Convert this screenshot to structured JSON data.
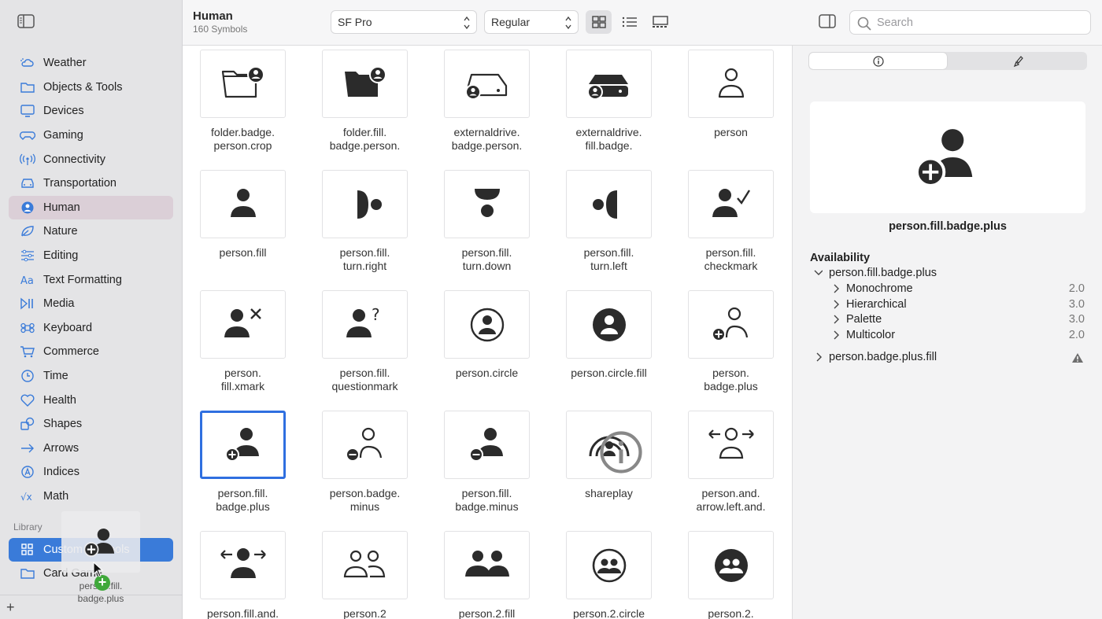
{
  "sidebar": {
    "categories": [
      {
        "label": "Weather",
        "icon": "cloud-sun-icon"
      },
      {
        "label": "Objects & Tools",
        "icon": "folder-icon"
      },
      {
        "label": "Devices",
        "icon": "display-icon"
      },
      {
        "label": "Gaming",
        "icon": "gamecontroller-icon"
      },
      {
        "label": "Connectivity",
        "icon": "antenna-icon"
      },
      {
        "label": "Transportation",
        "icon": "car-icon"
      },
      {
        "label": "Human",
        "icon": "person-circle-icon"
      },
      {
        "label": "Nature",
        "icon": "leaf-icon"
      },
      {
        "label": "Editing",
        "icon": "sliders-icon"
      },
      {
        "label": "Text Formatting",
        "icon": "textformat-icon"
      },
      {
        "label": "Media",
        "icon": "playpause-icon"
      },
      {
        "label": "Keyboard",
        "icon": "command-icon"
      },
      {
        "label": "Commerce",
        "icon": "cart-icon"
      },
      {
        "label": "Time",
        "icon": "clock-icon"
      },
      {
        "label": "Health",
        "icon": "heart-icon"
      },
      {
        "label": "Shapes",
        "icon": "shapes-icon"
      },
      {
        "label": "Arrows",
        "icon": "arrow-right-icon"
      },
      {
        "label": "Indices",
        "icon": "a-circle-icon"
      },
      {
        "label": "Math",
        "icon": "function-icon"
      }
    ],
    "selected_category": "Human",
    "library_label": "Library",
    "library": [
      {
        "label": "Custom Symbols",
        "icon": "grid-icon"
      },
      {
        "label": "Card Game",
        "icon": "folder-icon"
      }
    ],
    "drag_label": "person.fill.\nbadge.plus"
  },
  "toolbar": {
    "title": "Human",
    "subtitle": "160 Symbols",
    "font": "SF Pro",
    "weight": "Regular",
    "search_placeholder": "Search"
  },
  "grid": [
    {
      "label": "folder.badge.\nperson.crop",
      "icon": "folder-badge-person-icon"
    },
    {
      "label": "folder.fill.\nbadge.person.",
      "icon": "folder-fill-badge-person-icon"
    },
    {
      "label": "externaldrive.\nbadge.person.",
      "icon": "externaldrive-badge-person-icon"
    },
    {
      "label": "externaldrive.\nfill.badge.",
      "icon": "externaldrive-fill-badge-icon"
    },
    {
      "label": "person",
      "icon": "person-icon"
    },
    {
      "label": "person.fill",
      "icon": "person-fill-icon"
    },
    {
      "label": "person.fill.\nturn.right",
      "icon": "person-turn-right-icon"
    },
    {
      "label": "person.fill.\nturn.down",
      "icon": "person-turn-down-icon"
    },
    {
      "label": "person.fill.\nturn.left",
      "icon": "person-turn-left-icon"
    },
    {
      "label": "person.fill.\ncheckmark",
      "icon": "person-checkmark-icon"
    },
    {
      "label": "person.\nfill.xmark",
      "icon": "person-xmark-icon"
    },
    {
      "label": "person.fill.\nquestionmark",
      "icon": "person-questionmark-icon"
    },
    {
      "label": "person.circle",
      "icon": "person-circle-icon"
    },
    {
      "label": "person.circle.fill",
      "icon": "person-circle-fill-icon"
    },
    {
      "label": "person.\nbadge.plus",
      "icon": "person-badge-plus-icon"
    },
    {
      "label": "person.fill.\nbadge.plus",
      "icon": "person-fill-badge-plus-icon"
    },
    {
      "label": "person.badge.\nminus",
      "icon": "person-badge-minus-icon"
    },
    {
      "label": "person.fill.\nbadge.minus",
      "icon": "person-fill-badge-minus-icon"
    },
    {
      "label": "shareplay",
      "icon": "shareplay-icon"
    },
    {
      "label": "person.and.\narrow.left.and.",
      "icon": "person-arrows-icon"
    },
    {
      "label": "person.fill.and.",
      "icon": "person-fill-arrows-icon"
    },
    {
      "label": "person.2",
      "icon": "person-2-icon"
    },
    {
      "label": "person.2.fill",
      "icon": "person-2-fill-icon"
    },
    {
      "label": "person.2.circle",
      "icon": "person-2-circle-icon"
    },
    {
      "label": "person.2.",
      "icon": "person-2-circle-fill-icon"
    }
  ],
  "selected_symbol": "person.fill.badge.plus",
  "inspector": {
    "name": "person.fill.badge.plus",
    "availability_label": "Availability",
    "tree": {
      "label": "person.fill.badge.plus",
      "modes": [
        {
          "label": "Monochrome",
          "version": "2.0"
        },
        {
          "label": "Hierarchical",
          "version": "3.0"
        },
        {
          "label": "Palette",
          "version": "3.0"
        },
        {
          "label": "Multicolor",
          "version": "2.0"
        }
      ],
      "other": "person.badge.plus.fill"
    }
  }
}
